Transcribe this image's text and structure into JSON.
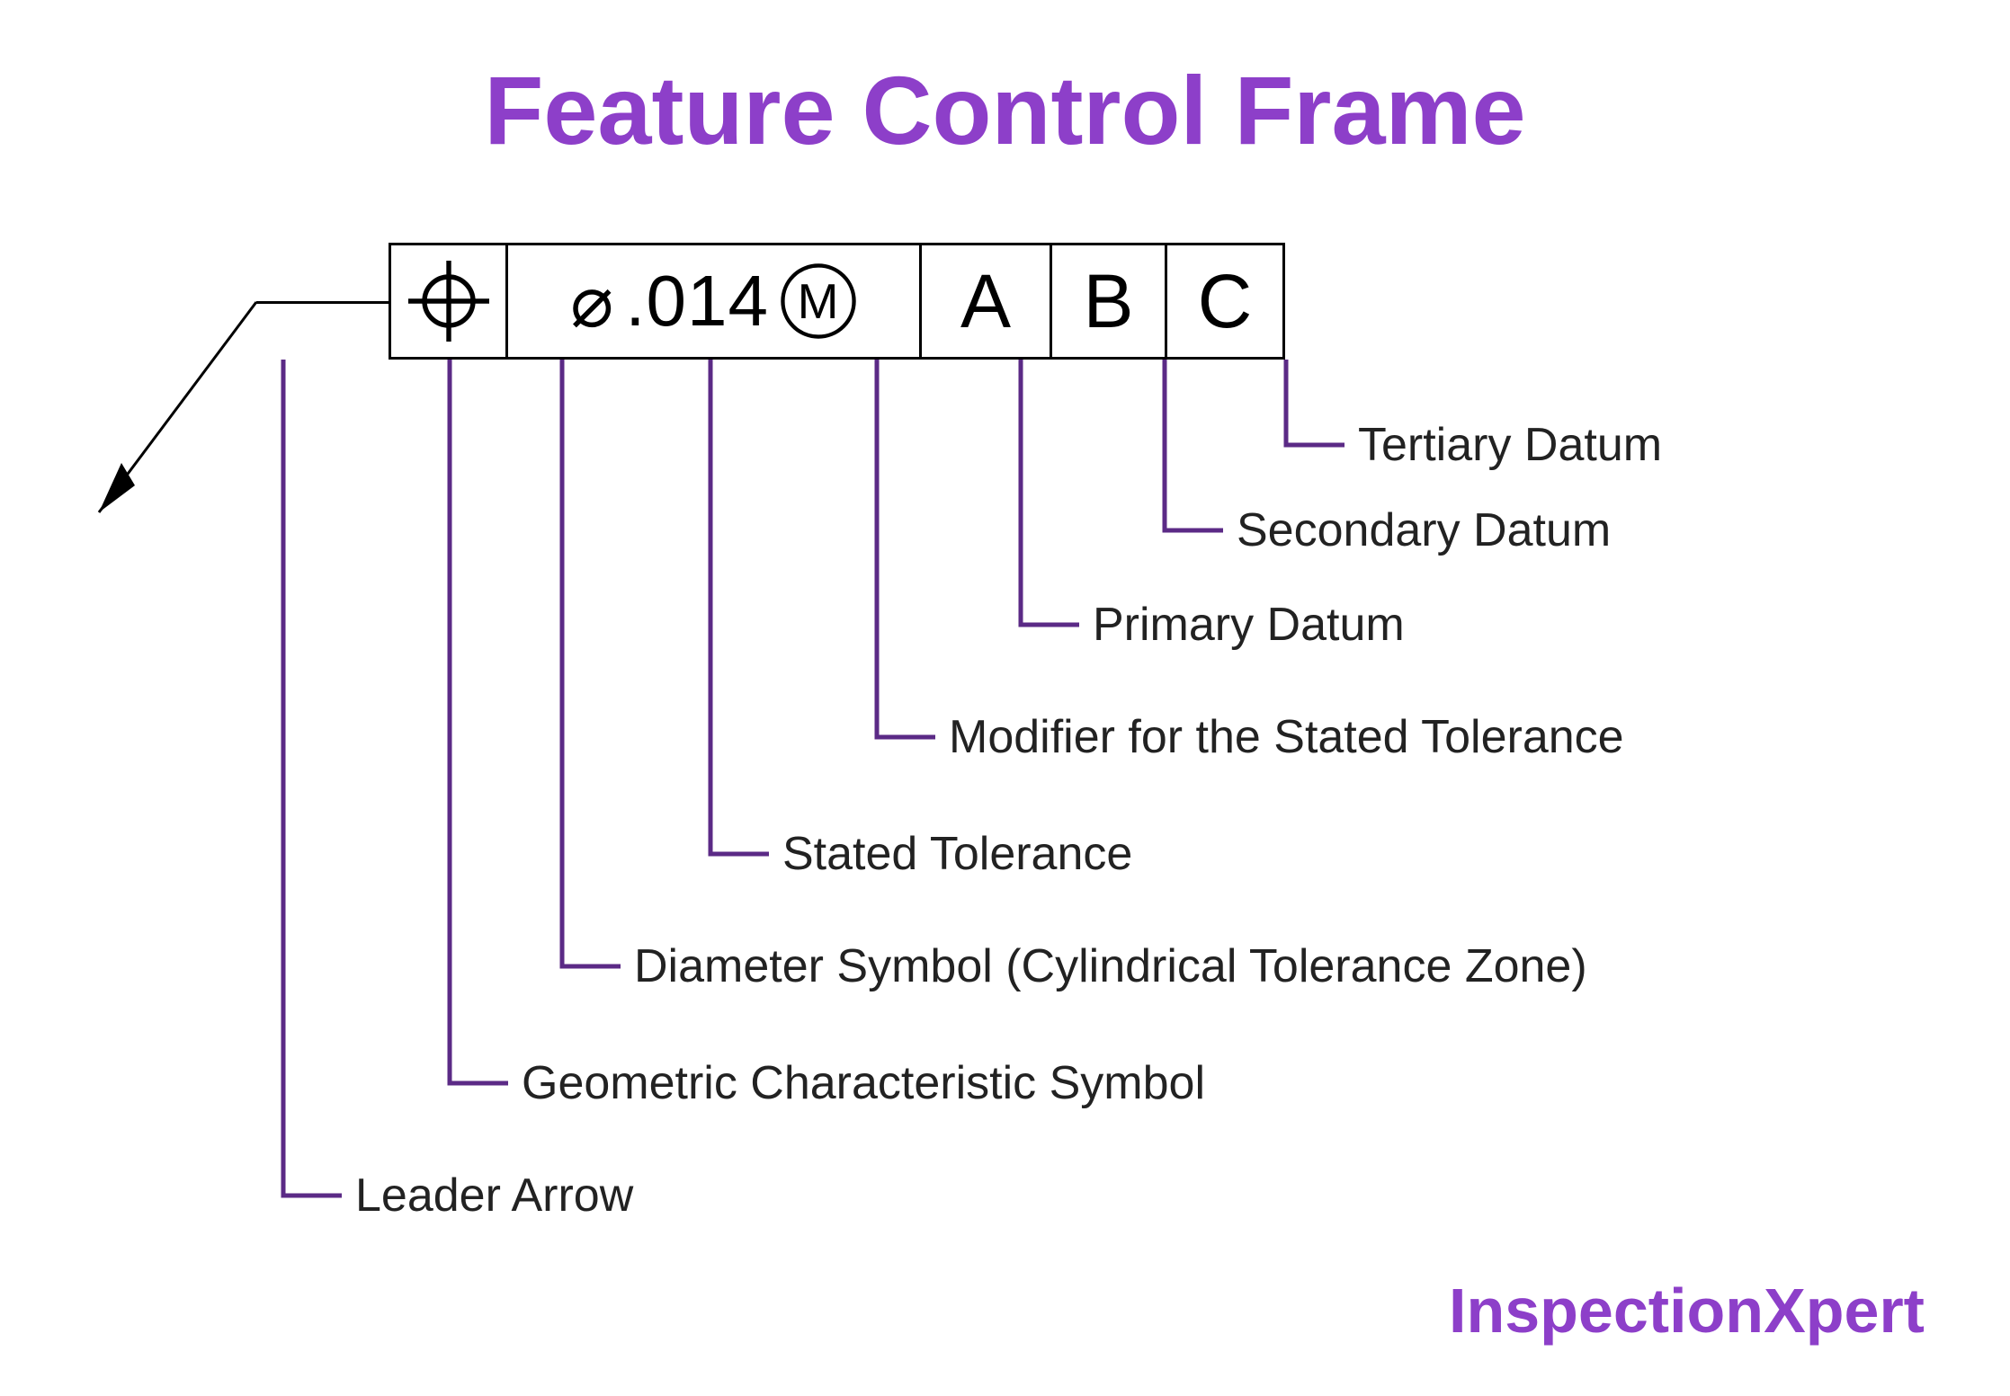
{
  "title": "Feature Control Frame",
  "fcf": {
    "geometric_symbol": "position",
    "diameter_symbol": "⌀",
    "tolerance_value": ".014",
    "modifier": "M",
    "datums": {
      "primary": "A",
      "secondary": "B",
      "tertiary": "C"
    }
  },
  "callouts": {
    "leader_arrow": "Leader Arrow",
    "geometric_char": "Geometric Characteristic Symbol",
    "diameter": "Diameter Symbol (Cylindrical Tolerance Zone)",
    "stated_tolerance": "Stated Tolerance",
    "modifier": "Modifier for the Stated Tolerance",
    "primary_datum": "Primary Datum",
    "secondary_datum": "Secondary Datum",
    "tertiary_datum": "Tertiary Datum"
  },
  "logo": {
    "part1": "Inspection",
    "part2": "Xpert"
  },
  "colors": {
    "accent": "#8d3fc9",
    "line": "#5b2a86"
  }
}
